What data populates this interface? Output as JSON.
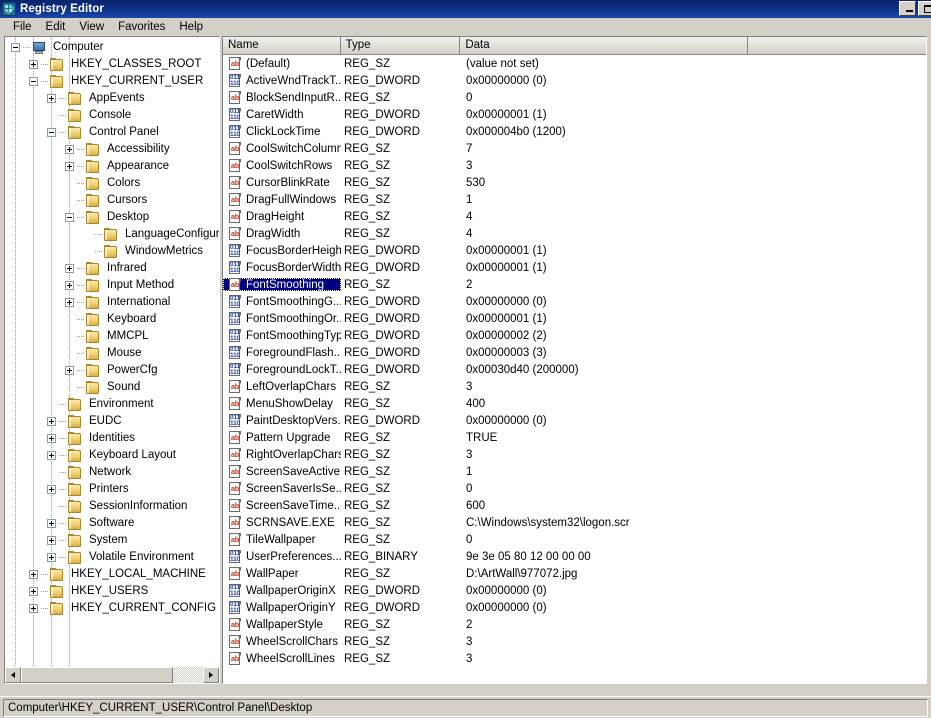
{
  "window": {
    "title": "Registry Editor",
    "icon": "registry-editor-icon",
    "buttons": {
      "minimize": "minimize-button",
      "maximize": "maximize-button"
    }
  },
  "menubar": {
    "items": [
      "File",
      "Edit",
      "View",
      "Favorites",
      "Help"
    ]
  },
  "tree": {
    "nodes": [
      {
        "label": "Computer",
        "depth": 0,
        "state": "minus",
        "icon": "computer-icon"
      },
      {
        "label": "HKEY_CLASSES_ROOT",
        "depth": 1,
        "state": "plus",
        "icon": "folder-icon"
      },
      {
        "label": "HKEY_CURRENT_USER",
        "depth": 1,
        "state": "minus",
        "icon": "folder-icon"
      },
      {
        "label": "AppEvents",
        "depth": 2,
        "state": "plus",
        "icon": "folder-icon"
      },
      {
        "label": "Console",
        "depth": 2,
        "state": "none",
        "icon": "folder-icon"
      },
      {
        "label": "Control Panel",
        "depth": 2,
        "state": "minus",
        "icon": "folder-icon"
      },
      {
        "label": "Accessibility",
        "depth": 3,
        "state": "plus",
        "icon": "folder-icon"
      },
      {
        "label": "Appearance",
        "depth": 3,
        "state": "plus",
        "icon": "folder-icon"
      },
      {
        "label": "Colors",
        "depth": 3,
        "state": "none",
        "icon": "folder-icon"
      },
      {
        "label": "Cursors",
        "depth": 3,
        "state": "none",
        "icon": "folder-icon"
      },
      {
        "label": "Desktop",
        "depth": 3,
        "state": "minus",
        "icon": "folder-icon"
      },
      {
        "label": "LanguageConfigura",
        "depth": 4,
        "state": "none",
        "icon": "folder-icon"
      },
      {
        "label": "WindowMetrics",
        "depth": 4,
        "state": "none",
        "icon": "folder-icon"
      },
      {
        "label": "Infrared",
        "depth": 3,
        "state": "plus",
        "icon": "folder-icon"
      },
      {
        "label": "Input Method",
        "depth": 3,
        "state": "plus",
        "icon": "folder-icon"
      },
      {
        "label": "International",
        "depth": 3,
        "state": "plus",
        "icon": "folder-icon"
      },
      {
        "label": "Keyboard",
        "depth": 3,
        "state": "none",
        "icon": "folder-icon"
      },
      {
        "label": "MMCPL",
        "depth": 3,
        "state": "none",
        "icon": "folder-icon"
      },
      {
        "label": "Mouse",
        "depth": 3,
        "state": "none",
        "icon": "folder-icon"
      },
      {
        "label": "PowerCfg",
        "depth": 3,
        "state": "plus",
        "icon": "folder-icon"
      },
      {
        "label": "Sound",
        "depth": 3,
        "state": "none",
        "icon": "folder-icon"
      },
      {
        "label": "Environment",
        "depth": 2,
        "state": "none",
        "icon": "folder-icon"
      },
      {
        "label": "EUDC",
        "depth": 2,
        "state": "plus",
        "icon": "folder-icon"
      },
      {
        "label": "Identities",
        "depth": 2,
        "state": "plus",
        "icon": "folder-icon"
      },
      {
        "label": "Keyboard Layout",
        "depth": 2,
        "state": "plus",
        "icon": "folder-icon"
      },
      {
        "label": "Network",
        "depth": 2,
        "state": "none",
        "icon": "folder-icon"
      },
      {
        "label": "Printers",
        "depth": 2,
        "state": "plus",
        "icon": "folder-icon"
      },
      {
        "label": "SessionInformation",
        "depth": 2,
        "state": "none",
        "icon": "folder-icon"
      },
      {
        "label": "Software",
        "depth": 2,
        "state": "plus",
        "icon": "folder-icon"
      },
      {
        "label": "System",
        "depth": 2,
        "state": "plus",
        "icon": "folder-icon"
      },
      {
        "label": "Volatile Environment",
        "depth": 2,
        "state": "plus",
        "icon": "folder-icon"
      },
      {
        "label": "HKEY_LOCAL_MACHINE",
        "depth": 1,
        "state": "plus",
        "icon": "folder-icon"
      },
      {
        "label": "HKEY_USERS",
        "depth": 1,
        "state": "plus",
        "icon": "folder-icon"
      },
      {
        "label": "HKEY_CURRENT_CONFIG",
        "depth": 1,
        "state": "plus",
        "icon": "folder-icon"
      }
    ]
  },
  "list": {
    "columns": [
      "Name",
      "Type",
      "Data",
      ""
    ],
    "rows": [
      {
        "name": "(Default)",
        "type": "REG_SZ",
        "data": "(value not set)",
        "icon": "string-value-icon",
        "selected": false
      },
      {
        "name": "ActiveWndTrackT...",
        "type": "REG_DWORD",
        "data": "0x00000000 (0)",
        "icon": "binary-value-icon",
        "selected": false
      },
      {
        "name": "BlockSendInputR...",
        "type": "REG_SZ",
        "data": "0",
        "icon": "string-value-icon",
        "selected": false
      },
      {
        "name": "CaretWidth",
        "type": "REG_DWORD",
        "data": "0x00000001 (1)",
        "icon": "binary-value-icon",
        "selected": false
      },
      {
        "name": "ClickLockTime",
        "type": "REG_DWORD",
        "data": "0x000004b0 (1200)",
        "icon": "binary-value-icon",
        "selected": false
      },
      {
        "name": "CoolSwitchColumns",
        "type": "REG_SZ",
        "data": "7",
        "icon": "string-value-icon",
        "selected": false
      },
      {
        "name": "CoolSwitchRows",
        "type": "REG_SZ",
        "data": "3",
        "icon": "string-value-icon",
        "selected": false
      },
      {
        "name": "CursorBlinkRate",
        "type": "REG_SZ",
        "data": "530",
        "icon": "string-value-icon",
        "selected": false
      },
      {
        "name": "DragFullWindows",
        "type": "REG_SZ",
        "data": "1",
        "icon": "string-value-icon",
        "selected": false
      },
      {
        "name": "DragHeight",
        "type": "REG_SZ",
        "data": "4",
        "icon": "string-value-icon",
        "selected": false
      },
      {
        "name": "DragWidth",
        "type": "REG_SZ",
        "data": "4",
        "icon": "string-value-icon",
        "selected": false
      },
      {
        "name": "FocusBorderHeight",
        "type": "REG_DWORD",
        "data": "0x00000001 (1)",
        "icon": "binary-value-icon",
        "selected": false
      },
      {
        "name": "FocusBorderWidth",
        "type": "REG_DWORD",
        "data": "0x00000001 (1)",
        "icon": "binary-value-icon",
        "selected": false
      },
      {
        "name": "FontSmoothing",
        "type": "REG_SZ",
        "data": "2",
        "icon": "string-value-icon",
        "selected": true
      },
      {
        "name": "FontSmoothingG...",
        "type": "REG_DWORD",
        "data": "0x00000000 (0)",
        "icon": "binary-value-icon",
        "selected": false
      },
      {
        "name": "FontSmoothingOr...",
        "type": "REG_DWORD",
        "data": "0x00000001 (1)",
        "icon": "binary-value-icon",
        "selected": false
      },
      {
        "name": "FontSmoothingType",
        "type": "REG_DWORD",
        "data": "0x00000002 (2)",
        "icon": "binary-value-icon",
        "selected": false
      },
      {
        "name": "ForegroundFlash...",
        "type": "REG_DWORD",
        "data": "0x00000003 (3)",
        "icon": "binary-value-icon",
        "selected": false
      },
      {
        "name": "ForegroundLockT...",
        "type": "REG_DWORD",
        "data": "0x00030d40 (200000)",
        "icon": "binary-value-icon",
        "selected": false
      },
      {
        "name": "LeftOverlapChars",
        "type": "REG_SZ",
        "data": "3",
        "icon": "string-value-icon",
        "selected": false
      },
      {
        "name": "MenuShowDelay",
        "type": "REG_SZ",
        "data": "400",
        "icon": "string-value-icon",
        "selected": false
      },
      {
        "name": "PaintDesktopVers...",
        "type": "REG_DWORD",
        "data": "0x00000000 (0)",
        "icon": "binary-value-icon",
        "selected": false
      },
      {
        "name": "Pattern Upgrade",
        "type": "REG_SZ",
        "data": "TRUE",
        "icon": "string-value-icon",
        "selected": false
      },
      {
        "name": "RightOverlapChars",
        "type": "REG_SZ",
        "data": "3",
        "icon": "string-value-icon",
        "selected": false
      },
      {
        "name": "ScreenSaveActive",
        "type": "REG_SZ",
        "data": "1",
        "icon": "string-value-icon",
        "selected": false
      },
      {
        "name": "ScreenSaverIsSe...",
        "type": "REG_SZ",
        "data": "0",
        "icon": "string-value-icon",
        "selected": false
      },
      {
        "name": "ScreenSaveTime...",
        "type": "REG_SZ",
        "data": "600",
        "icon": "string-value-icon",
        "selected": false
      },
      {
        "name": "SCRNSAVE.EXE",
        "type": "REG_SZ",
        "data": "C:\\Windows\\system32\\logon.scr",
        "icon": "string-value-icon",
        "selected": false
      },
      {
        "name": "TileWallpaper",
        "type": "REG_SZ",
        "data": "0",
        "icon": "string-value-icon",
        "selected": false
      },
      {
        "name": "UserPreferences...",
        "type": "REG_BINARY",
        "data": "9e 3e 05 80 12 00 00 00",
        "icon": "binary-value-icon",
        "selected": false
      },
      {
        "name": "WallPaper",
        "type": "REG_SZ",
        "data": "D:\\ArtWall\\977072.jpg",
        "icon": "string-value-icon",
        "selected": false
      },
      {
        "name": "WallpaperOriginX",
        "type": "REG_DWORD",
        "data": "0x00000000 (0)",
        "icon": "binary-value-icon",
        "selected": false
      },
      {
        "name": "WallpaperOriginY",
        "type": "REG_DWORD",
        "data": "0x00000000 (0)",
        "icon": "binary-value-icon",
        "selected": false
      },
      {
        "name": "WallpaperStyle",
        "type": "REG_SZ",
        "data": "2",
        "icon": "string-value-icon",
        "selected": false
      },
      {
        "name": "WheelScrollChars",
        "type": "REG_SZ",
        "data": "3",
        "icon": "string-value-icon",
        "selected": false
      },
      {
        "name": "WheelScrollLines",
        "type": "REG_SZ",
        "data": "3",
        "icon": "string-value-icon",
        "selected": false
      }
    ]
  },
  "statusbar": {
    "path": "Computer\\HKEY_CURRENT_USER\\Control Panel\\Desktop"
  },
  "colors": {
    "titlebar_start": "#0a246a",
    "titlebar_end": "#1a49a8",
    "face": "#d4d0c8",
    "selection": "#000080",
    "string_icon": "#c83c1e",
    "binary_icon": "#2040a8"
  }
}
